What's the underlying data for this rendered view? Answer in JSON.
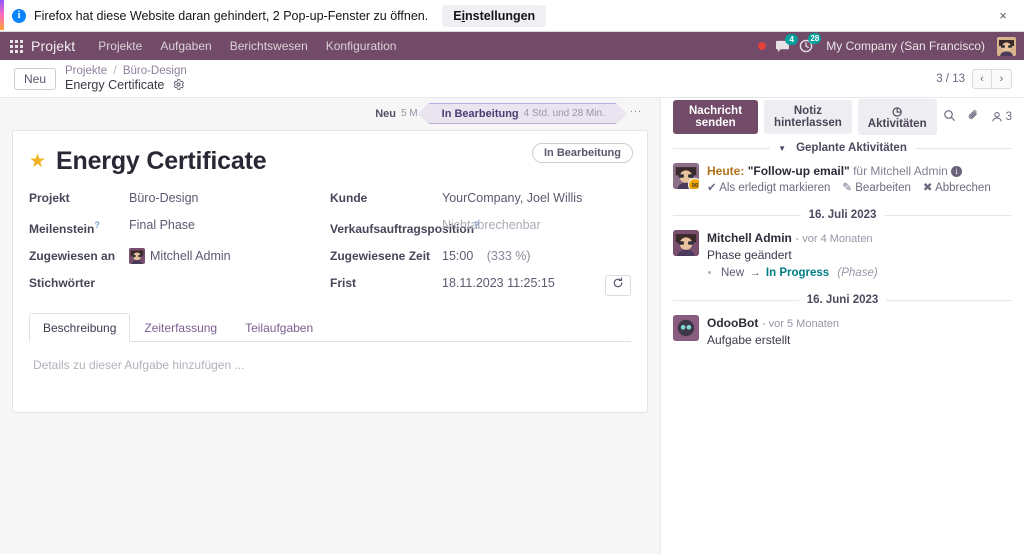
{
  "browser_notification": {
    "info_icon": "info-icon",
    "message": "Firefox hat diese Website daran gehindert, 2 Pop-up-Fenster zu öffnen.",
    "settings_button_prefix": "E",
    "settings_button_underlined": "i",
    "settings_button_suffix": "nstellungen",
    "close_icon": "×"
  },
  "navbar": {
    "apps_icon": "apps-grid-icon",
    "brand": "Projekt",
    "menu": [
      {
        "label": "Projekte"
      },
      {
        "label": "Aufgaben"
      },
      {
        "label": "Berichtswesen"
      },
      {
        "label": "Konfiguration"
      }
    ],
    "messages_badge": "4",
    "activities_badge": "28",
    "company": "My Company (San Francisco)",
    "accent_color": "#714b67"
  },
  "control_panel": {
    "new_button": "Neu",
    "breadcrumb_root": "Projekte",
    "breadcrumb_parent": "Büro-Design",
    "breadcrumb_current": "Energy Certificate",
    "gear_icon": "gear-icon",
    "pager": "3 / 13",
    "prev_icon": "‹",
    "next_icon": "›"
  },
  "statusbar": {
    "stages": [
      {
        "label": "Neu",
        "duration": "5 M",
        "active": false
      },
      {
        "label": "In Bearbeitung",
        "duration": "4 Std. und 28 Min.",
        "active": true
      }
    ],
    "more": "..."
  },
  "chatter_toolbar": {
    "send_message": "Nachricht senden",
    "log_note": "Notiz hinterlassen",
    "activities": "Aktivitäten",
    "activities_icon": "clock-icon",
    "search_icon": "search-icon",
    "attachment_icon": "paperclip-icon",
    "followers_icon": "user-icon",
    "followers_count": "3"
  },
  "form": {
    "ribbon": "In Bearbeitung",
    "star_icon": "star-icon",
    "title": "Energy Certificate",
    "left_fields": [
      {
        "label": "Projekt",
        "value": "Büro-Design",
        "help": false,
        "type": "text"
      },
      {
        "label": "Meilenstein",
        "value": "Final Phase",
        "help": true,
        "type": "text"
      },
      {
        "label": "Zugewiesen an",
        "value": "Mitchell Admin",
        "help": false,
        "type": "avatar"
      },
      {
        "label": "Stichwörter",
        "value": "",
        "help": false,
        "type": "text"
      }
    ],
    "right_fields": [
      {
        "label": "Kunde",
        "value": "YourCompany, Joel Willis",
        "help": false,
        "type": "text"
      },
      {
        "label": "Verkaufsauftragsposition",
        "value": "Nichtabrechenbar",
        "help": true,
        "type": "placeholder"
      },
      {
        "label": "Zugewiesene Zeit",
        "value": "15:00",
        "extra": "(333 %)",
        "help": false,
        "type": "time"
      },
      {
        "label": "Frist",
        "value": "18.11.2023 11:25:15",
        "help": false,
        "type": "date",
        "refresh_icon": "refresh-icon"
      }
    ],
    "tabs": [
      {
        "label": "Beschreibung",
        "active": true
      },
      {
        "label": "Zeiterfassung",
        "active": false
      },
      {
        "label": "Teilaufgaben",
        "active": false
      }
    ],
    "description_placeholder": "Details zu dieser Aufgabe hinzufügen ..."
  },
  "chatter": {
    "activities_header": "Geplante Aktivitäten",
    "activity": {
      "avatar_badge_icon": "envelope-icon",
      "today_label": "Heute:",
      "summary": "\"Follow-up email\"",
      "assigned_to": "für Mitchell Admin",
      "info_icon": "i",
      "mark_done": "Als erledigt markieren",
      "mark_done_icon": "✔",
      "edit": "Bearbeiten",
      "edit_icon": "✎",
      "cancel": "Abbrechen",
      "cancel_icon": "✖"
    },
    "threads": [
      {
        "date_separator": "16. Juli 2023",
        "author": "Mitchell Admin",
        "when": "- vor 4 Monaten",
        "body": "Phase geändert",
        "tracking": {
          "old": "New",
          "arrow": "→",
          "new": "In Progress",
          "field": "(Phase)"
        }
      },
      {
        "date_separator": "16. Juni 2023",
        "author": "OdooBot",
        "when": "- vor 5 Monaten",
        "body": "Aufgabe erstellt",
        "tracking": null
      }
    ]
  }
}
